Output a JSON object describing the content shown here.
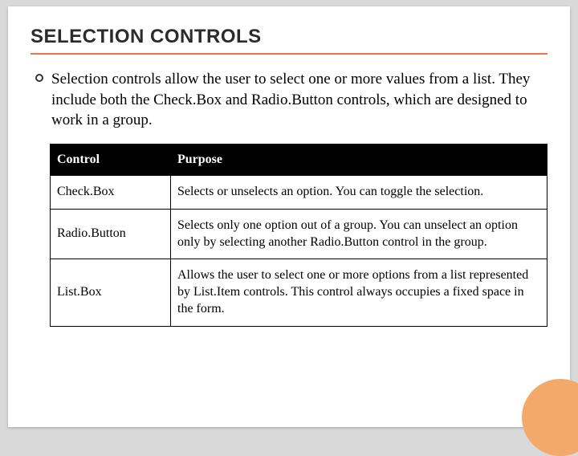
{
  "title": "SELECTION CONTROLS",
  "paragraph": "Selection controls allow the user to select one or more values from a list. They include both the Check.Box and Radio.Button controls, which are designed to work in a group.",
  "table": {
    "headers": {
      "control": "Control",
      "purpose": "Purpose"
    },
    "rows": [
      {
        "control": "Check.Box",
        "purpose": "Selects or unselects an option. You can toggle the selection."
      },
      {
        "control": "Radio.Button",
        "purpose": "Selects only one option out of a group. You can unselect an option only by selecting another Radio.Button control in the group."
      },
      {
        "control": "List.Box",
        "purpose": "Allows the user to select one or more options from a list represented by List.Item controls. This control always occupies a fixed space in the form."
      }
    ]
  }
}
